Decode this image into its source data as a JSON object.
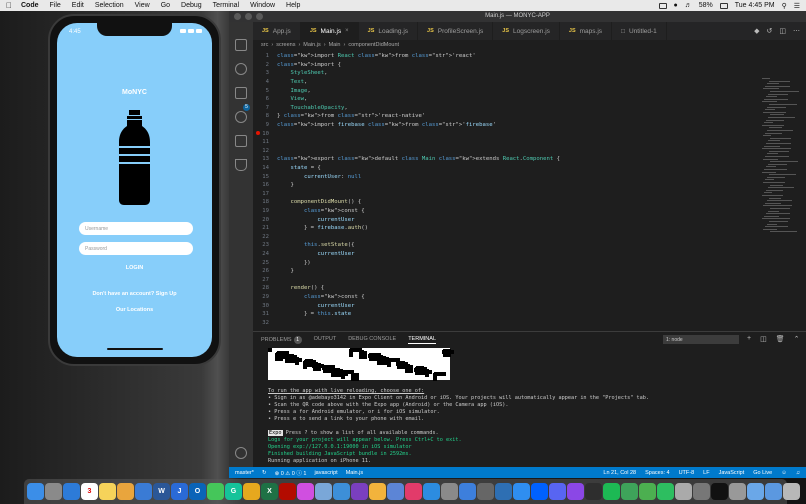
{
  "menubar": {
    "app_name": "Code",
    "items": [
      "File",
      "Edit",
      "Selection",
      "View",
      "Go",
      "Debug",
      "Terminal",
      "Window",
      "Help"
    ],
    "battery": "58%",
    "clock": "Tue 4:45 PM"
  },
  "phone": {
    "time": "4:45",
    "app_title": "MoNYC",
    "username_placeholder": "Username",
    "password_placeholder": "Password",
    "login_label": "LOGIN",
    "signup_text": "Don't have an account? Sign Up",
    "locations_text": "Our Locations"
  },
  "window": {
    "title": "Main.js — MONYC-APP"
  },
  "tabs": [
    {
      "label": "App.js",
      "active": false
    },
    {
      "label": "Main.js",
      "active": true
    },
    {
      "label": "Loading.js",
      "active": false
    },
    {
      "label": "ProfileScreen.js",
      "active": false
    },
    {
      "label": "Logscreen.js",
      "active": false
    },
    {
      "label": "maps.js",
      "active": false
    },
    {
      "label": "Untitled-1",
      "active": false
    }
  ],
  "breadcrumb": {
    "folder": "src",
    "subfolder": "screens",
    "file": "Main.js",
    "class": "Main",
    "method": "componentDidMount"
  },
  "code": [
    {
      "n": "1",
      "t": "import React from 'react'"
    },
    {
      "n": "2",
      "t": "import {"
    },
    {
      "n": "3",
      "t": "    StyleSheet,"
    },
    {
      "n": "4",
      "t": "    Text,"
    },
    {
      "n": "5",
      "t": "    Image,"
    },
    {
      "n": "6",
      "t": "    View,"
    },
    {
      "n": "7",
      "t": "    TouchableOpacity,"
    },
    {
      "n": "8",
      "t": "} from 'react-native'"
    },
    {
      "n": "9",
      "t": "import firebase from 'firebase'"
    },
    {
      "n": "10",
      "t": ""
    },
    {
      "n": "11",
      "t": ""
    },
    {
      "n": "12",
      "t": ""
    },
    {
      "n": "13",
      "t": "export default class Main extends React.Component {"
    },
    {
      "n": "14",
      "t": "    state = {"
    },
    {
      "n": "15",
      "t": "        currentUser: null"
    },
    {
      "n": "16",
      "t": "    }"
    },
    {
      "n": "17",
      "t": ""
    },
    {
      "n": "18",
      "t": "    componentDidMount() {"
    },
    {
      "n": "19",
      "t": "        const {"
    },
    {
      "n": "20",
      "t": "            currentUser"
    },
    {
      "n": "21",
      "t": "        } = firebase.auth()"
    },
    {
      "n": "22",
      "t": ""
    },
    {
      "n": "23",
      "t": "        this.setState({"
    },
    {
      "n": "24",
      "t": "            currentUser"
    },
    {
      "n": "25",
      "t": "        })"
    },
    {
      "n": "26",
      "t": "    }"
    },
    {
      "n": "27",
      "t": ""
    },
    {
      "n": "28",
      "t": "    render() {"
    },
    {
      "n": "29",
      "t": "        const {"
    },
    {
      "n": "30",
      "t": "            currentUser"
    },
    {
      "n": "31",
      "t": "        } = this.state"
    },
    {
      "n": "32",
      "t": ""
    }
  ],
  "panel": {
    "tabs": [
      "PROBLEMS",
      "OUTPUT",
      "DEBUG CONSOLE",
      "TERMINAL"
    ],
    "problems_count": "1",
    "terminal_select": "1: node",
    "lines": [
      {
        "t": "To run the app with live reloading, choose one of:",
        "u": true
      },
      {
        "t": "• Sign in as @adebayo3142 in Expo Client on Android or iOS. Your projects will automatically appear in the \"Projects\" tab."
      },
      {
        "t": "• Scan the QR code above with the Expo app (Android) or the Camera app (iOS)."
      },
      {
        "t": "• Press a for Android emulator, or i for iOS simulator."
      },
      {
        "t": "• Press e to send a link to your phone with email."
      }
    ],
    "expo_tag": "Expo",
    "expo_line": " Press ? to show a list of all available commands.",
    "green_lines": [
      "Logs for your project will appear below. Press Ctrl+C to exit.",
      "Opening exp://127.0.0.1:19000 in iOS simulator",
      "Finished building JavaScript bundle in 2592ms."
    ],
    "last_line": "Running application on iPhone 11."
  },
  "statusbar": {
    "branch": "master*",
    "errors": "0",
    "warnings": "0",
    "info": "1",
    "language_mode": "javascript",
    "file": "Main.js",
    "position": "Ln 21, Col 28",
    "spaces": "Spaces: 4",
    "encoding": "UTF-8",
    "eol": "LF",
    "language": "JavaScript",
    "golive": "Go Live"
  },
  "dock": [
    {
      "name": "finder",
      "color": "#3b8ee8",
      "g": ""
    },
    {
      "name": "launchpad",
      "color": "#8a8a8a",
      "g": ""
    },
    {
      "name": "safari",
      "color": "#2d7bd8",
      "g": ""
    },
    {
      "name": "calendar",
      "color": "#ffffff",
      "g": "3"
    },
    {
      "name": "notes",
      "color": "#f6d35a",
      "g": ""
    },
    {
      "name": "photos",
      "color": "#e9a53d",
      "g": ""
    },
    {
      "name": "mail",
      "color": "#3a7bd5",
      "g": ""
    },
    {
      "name": "word",
      "color": "#2b5797",
      "g": "W"
    },
    {
      "name": "jira",
      "color": "#2a6ad6",
      "g": "J"
    },
    {
      "name": "outlook",
      "color": "#0a64b8",
      "g": "O"
    },
    {
      "name": "messages",
      "color": "#45c65a",
      "g": ""
    },
    {
      "name": "grammarly",
      "color": "#15c39a",
      "g": "G"
    },
    {
      "name": "chrome",
      "color": "#e6a81e",
      "g": ""
    },
    {
      "name": "excel",
      "color": "#1e7145",
      "g": "X"
    },
    {
      "name": "acrobat",
      "color": "#b30b00",
      "g": ""
    },
    {
      "name": "itunes",
      "color": "#d04fe0",
      "g": ""
    },
    {
      "name": "preview",
      "color": "#7aa7d8",
      "g": ""
    },
    {
      "name": "xcode",
      "color": "#3d8fd8",
      "g": ""
    },
    {
      "name": "github",
      "color": "#7a3fbf",
      "g": ""
    },
    {
      "name": "sketch",
      "color": "#f2b33c",
      "g": ""
    },
    {
      "name": "tools",
      "color": "#5c85d6",
      "g": ""
    },
    {
      "name": "intellij",
      "color": "#e23b6a",
      "g": ""
    },
    {
      "name": "vscode",
      "color": "#2c8ce0",
      "g": ""
    },
    {
      "name": "simulator",
      "color": "#8a8a8a",
      "g": ""
    },
    {
      "name": "keynote",
      "color": "#3d7fdc",
      "g": ""
    },
    {
      "name": "vmware",
      "color": "#666666",
      "g": ""
    },
    {
      "name": "virtualbox",
      "color": "#2e6fb3",
      "g": ""
    },
    {
      "name": "appstore",
      "color": "#2f8ef0",
      "g": ""
    },
    {
      "name": "dropbox",
      "color": "#0061fe",
      "g": ""
    },
    {
      "name": "discord",
      "color": "#5865f2",
      "g": ""
    },
    {
      "name": "messenger",
      "color": "#8b47e6",
      "g": ""
    },
    {
      "name": "terminal-app",
      "color": "#2e2e2e",
      "g": ""
    },
    {
      "name": "spotify",
      "color": "#1db954",
      "g": ""
    },
    {
      "name": "sync",
      "color": "#3ea35a",
      "g": ""
    },
    {
      "name": "maps",
      "color": "#4caf50",
      "g": ""
    },
    {
      "name": "evernote",
      "color": "#2dbe60",
      "g": ""
    },
    {
      "name": "printer",
      "color": "#aaaaaa",
      "g": ""
    },
    {
      "name": "automator",
      "color": "#777777",
      "g": ""
    },
    {
      "name": "iterm",
      "color": "#111111",
      "g": ""
    },
    {
      "name": "archive",
      "color": "#999999",
      "g": ""
    },
    {
      "name": "folder",
      "color": "#6aa7e8",
      "g": ""
    },
    {
      "name": "downloads",
      "color": "#5b98e0",
      "g": ""
    },
    {
      "name": "trash",
      "color": "#b8b8b8",
      "g": ""
    }
  ]
}
